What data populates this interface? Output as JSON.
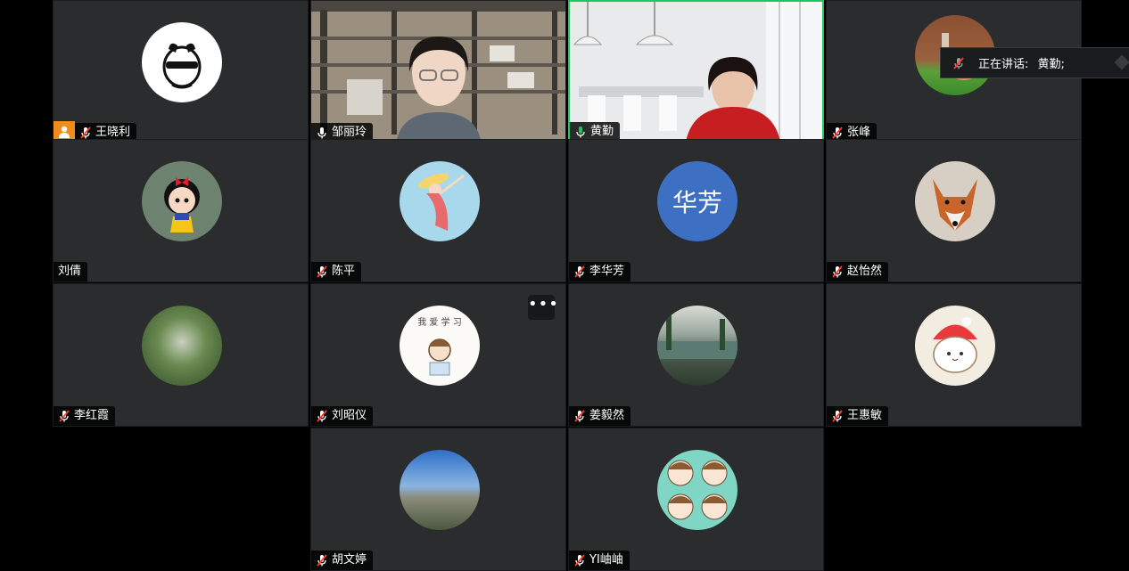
{
  "speaking_indicator": {
    "label": "正在讲话:",
    "speaker": "黄勤;"
  },
  "more_button_label": "•••",
  "participants": [
    {
      "name": "王晓利",
      "mic": "muted",
      "host": true
    },
    {
      "name": "邹丽玲",
      "mic": "on",
      "video": true
    },
    {
      "name": "黄勤",
      "mic": "on",
      "video": true,
      "speaking": true
    },
    {
      "name": "张峰",
      "mic": "muted"
    },
    {
      "name": "刘倩",
      "mic": "none"
    },
    {
      "name": "陈平",
      "mic": "muted"
    },
    {
      "name": "李华芳",
      "mic": "muted",
      "avatar_text": "华芳",
      "avatar_color": "#3d6fc2"
    },
    {
      "name": "赵怡然",
      "mic": "muted"
    },
    {
      "name": "李红霞",
      "mic": "muted"
    },
    {
      "name": "刘昭仪",
      "mic": "muted",
      "avatar_text": "我 爱 学 习"
    },
    {
      "name": "姜毅然",
      "mic": "muted"
    },
    {
      "name": "王惠敏",
      "mic": "muted"
    },
    {
      "name": "胡文婷",
      "mic": "muted"
    },
    {
      "name": "YI岫岫",
      "mic": "muted"
    }
  ],
  "colors": {
    "tile_bg": "#2b2c2e",
    "active_border": "#22c55e",
    "host_badge": "#f08c1c",
    "mute_icon": "#ff3b30"
  }
}
